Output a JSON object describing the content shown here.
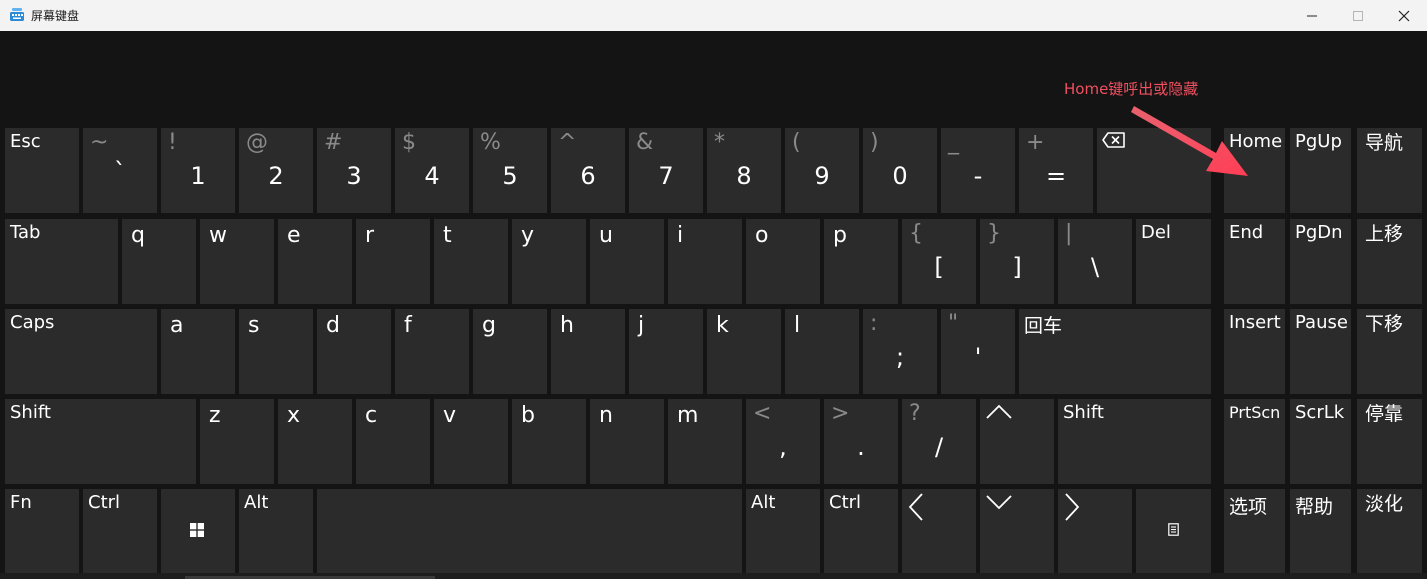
{
  "window": {
    "title": "屏幕键盘",
    "icons": {
      "app": "keyboard-icon",
      "minimize": "minimize-icon",
      "maximize": "maximize-icon",
      "close": "close-icon"
    }
  },
  "annotation": {
    "text": "Home键呼出或隐藏",
    "color": "#f05060",
    "arrow_icon": "red-arrow-icon"
  },
  "colors": {
    "key_bg": "#2b2b2b",
    "keyboard_bg": "#141414",
    "key_text": "#ffffff",
    "shift_text": "#8a8a8a"
  },
  "keys": {
    "esc": "Esc",
    "tilde": {
      "shift": "~",
      "main": "`"
    },
    "n1": {
      "shift": "!",
      "main": "1"
    },
    "n2": {
      "shift": "@",
      "main": "2"
    },
    "n3": {
      "shift": "#",
      "main": "3"
    },
    "n4": {
      "shift": "$",
      "main": "4"
    },
    "n5": {
      "shift": "%",
      "main": "5"
    },
    "n6": {
      "shift": "^",
      "main": "6"
    },
    "n7": {
      "shift": "&",
      "main": "7"
    },
    "n8": {
      "shift": "*",
      "main": "8"
    },
    "n9": {
      "shift": "(",
      "main": "9"
    },
    "n0": {
      "shift": ")",
      "main": "0"
    },
    "minus": {
      "shift": "_",
      "main": "-"
    },
    "equals": {
      "shift": "+",
      "main": "="
    },
    "backspace_icon": "backspace-icon",
    "tab": "Tab",
    "q": "q",
    "w": "w",
    "e": "e",
    "r": "r",
    "t": "t",
    "y": "y",
    "u": "u",
    "i": "i",
    "o": "o",
    "p": "p",
    "lbracket": {
      "shift": "{",
      "main": "["
    },
    "rbracket": {
      "shift": "}",
      "main": "]"
    },
    "backslash": {
      "shift": "|",
      "main": "\\"
    },
    "del": "Del",
    "caps": "Caps",
    "a": "a",
    "s": "s",
    "d": "d",
    "f": "f",
    "g": "g",
    "h": "h",
    "j": "j",
    "k": "k",
    "l": "l",
    "semicolon": {
      "shift": ":",
      "main": ";"
    },
    "quote": {
      "shift": "\"",
      "main": "'"
    },
    "enter": "回车",
    "shift_left": "Shift",
    "z": "z",
    "x": "x",
    "c": "c",
    "v": "v",
    "b": "b",
    "n": "n",
    "m": "m",
    "comma": {
      "shift": "<",
      "main": ","
    },
    "period": {
      "shift": ">",
      "main": "."
    },
    "slash": {
      "shift": "?",
      "main": "/"
    },
    "up_icon": "arrow-up-icon",
    "shift_right": "Shift",
    "fn": "Fn",
    "ctrl_left": "Ctrl",
    "win_icon": "windows-icon",
    "alt_left": "Alt",
    "alt_right": "Alt",
    "ctrl_right": "Ctrl",
    "left_icon": "arrow-left-icon",
    "down_icon": "arrow-down-icon",
    "right_icon": "arrow-right-icon",
    "menu_icon": "context-menu-icon",
    "home": "Home",
    "pgup": "PgUp",
    "nav": "导航",
    "end": "End",
    "pgdn": "PgDn",
    "moveup": "上移",
    "insert": "Insert",
    "pause": "Pause",
    "movedown": "下移",
    "prtscn": "PrtScn",
    "scrlk": "ScrLk",
    "dock": "停靠",
    "options": "选项",
    "help": "帮助",
    "fade": "淡化"
  }
}
